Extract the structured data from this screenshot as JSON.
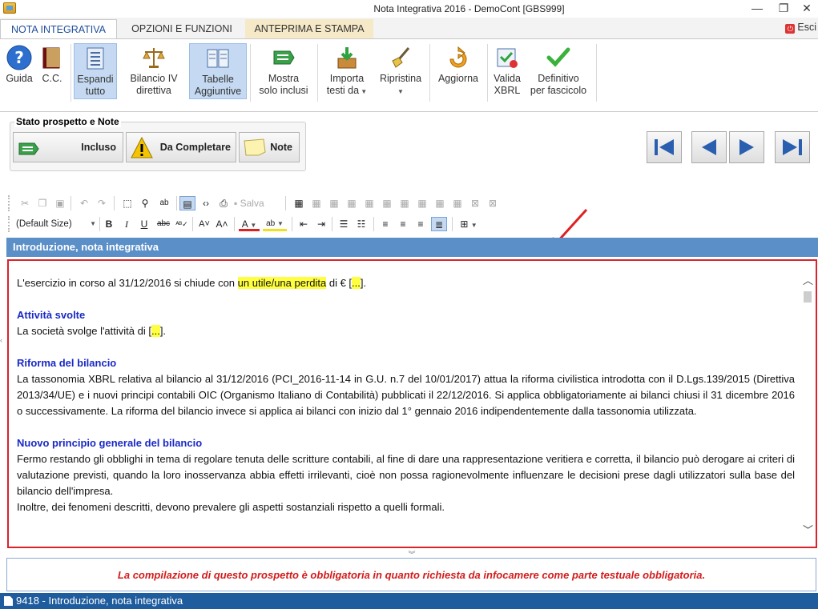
{
  "window": {
    "title": "Nota Integrativa 2016 - DemoCont [GBS999]",
    "minimize": "—",
    "restore": "❐",
    "close": "✕"
  },
  "ribbon_tabs": [
    {
      "label": "NOTA INTEGRATIVA"
    },
    {
      "label": "OPZIONI E FUNZIONI"
    },
    {
      "label": "ANTEPRIMA E STAMPA"
    }
  ],
  "exit_label": "Esci",
  "ribbon": {
    "guida": "Guida",
    "cc": "C.C.",
    "espandi_1": "Espandi",
    "espandi_2": "tutto",
    "bilancio_1": "Bilancio IV",
    "bilancio_2": "direttiva",
    "tabelle_1": "Tabelle",
    "tabelle_2": "Aggiuntive",
    "mostra_1": "Mostra",
    "mostra_2": "solo inclusi",
    "importa_1": "Importa",
    "importa_2": "testi da",
    "ripristina": "Ripristina",
    "aggiorna": "Aggiorna",
    "valida_1": "Valida",
    "valida_2": "XBRL",
    "definitivo_1": "Definitivo",
    "definitivo_2": "per fascicolo"
  },
  "status_panel": {
    "title": "Stato prospetto e Note",
    "incluso": "Incluso",
    "da_completare": "Da Completare",
    "note": "Note"
  },
  "toolbar": {
    "salva": "Salva",
    "font_size": "(Default Size)"
  },
  "section_header": "Introduzione, nota integrativa",
  "document": {
    "p1_a": "L'esercizio in corso al 31/12/2016 si chiude con ",
    "p1_hl": "un utile/una perdita",
    "p1_b": " di € [",
    "p1_hl2": "...",
    "p1_c": "].",
    "h_attivita": "Attività svolte",
    "p2_a": "La società svolge l'attività di [",
    "p2_hl": "...",
    "p2_b": "].",
    "h_riforma": "Riforma del bilancio",
    "p3": "La tassonomia XBRL relativa al bilancio al 31/12/2016 (PCI_2016-11-14 in G.U. n.7 del 10/01/2017) attua la riforma civilistica introdotta con il D.Lgs.139/2015 (Direttiva 2013/34/UE) e i nuovi principi contabili OIC (Organismo Italiano di Contabilità) pubblicati il 22/12/2016. Si applica obbligatoriamente ai bilanci chiusi il 31 dicembre 2016 o successivamente. La riforma del bilancio invece si applica ai bilanci con inizio dal 1° gennaio 2016 indipendentemente dalla tassonomia utilizzata.",
    "h_principio": "Nuovo principio generale del bilancio",
    "p4": "Fermo restando gli obblighi in tema di regolare tenuta delle scritture contabili, al fine di dare una rappresentazione veritiera e corretta, il bilancio può derogare ai criteri di valutazione previsti, quando la loro inosservanza abbia effetti irrilevanti, cioè non possa ragionevolmente influenzare le decisioni prese dagli utilizzatori sulla base del bilancio dell'impresa.",
    "p5": "Inoltre, dei fenomeni descritti, devono prevalere gli aspetti sostanziali rispetto a quelli formali."
  },
  "notice": "La compilazione di questo prospetto è obbligatoria in quanto richiesta da infocamere come parte testuale obbligatoria.",
  "statusbar": "9418 - Introduzione, nota integrativa",
  "colors": {
    "accent_blue": "#5b8fc7",
    "statusbar": "#1e5c9d",
    "highlight": "#ffff40",
    "heading": "#1a29c6",
    "alert_red": "#d21c1c"
  }
}
